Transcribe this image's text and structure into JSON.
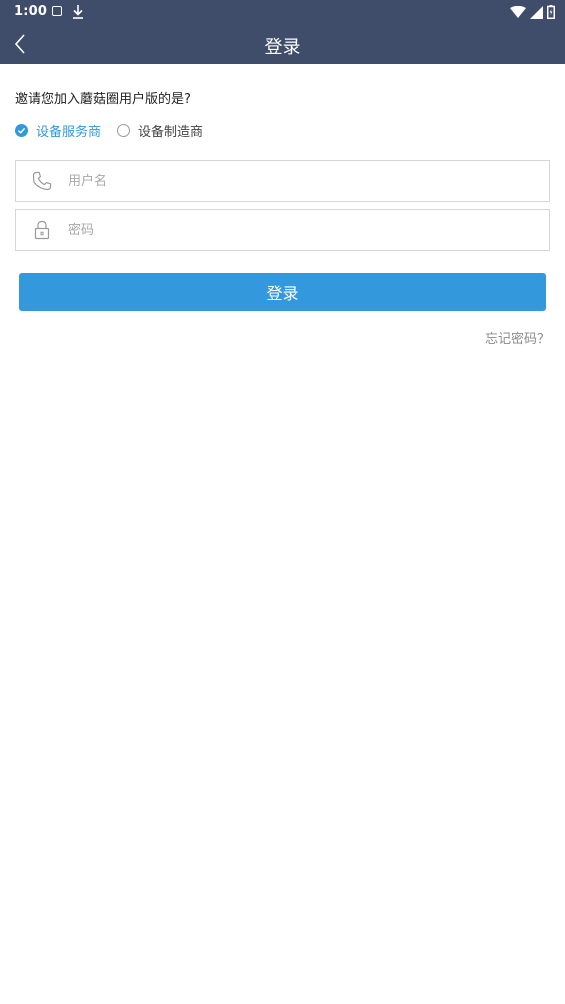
{
  "status_bar": {
    "time": "1:00"
  },
  "toolbar": {
    "title": "登录"
  },
  "form": {
    "question": "邀请您加入蘑菇圈用户版的是?",
    "options": [
      {
        "label": "设备服务商",
        "checked": true
      },
      {
        "label": "设备制造商",
        "checked": false
      }
    ],
    "username": {
      "placeholder": "用户名",
      "value": ""
    },
    "password": {
      "placeholder": "密码",
      "value": ""
    },
    "login_label": "登录",
    "forgot_label": "忘记密码？"
  },
  "colors": {
    "header": "#3f4d6b",
    "accent": "#3398dc"
  }
}
